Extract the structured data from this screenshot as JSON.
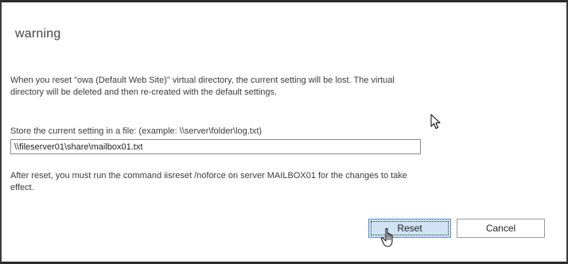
{
  "dialog": {
    "title": "warning",
    "warning_message": "When you reset \"owa (Default Web Site)\" virtual directory, the current setting will be lost. The virtual directory will be deleted and then re-created with the default settings.",
    "store_label": "Store the current setting in a file: (example: \\\\server\\folder\\log.txt)",
    "file_path_value": "\\\\fileserver01\\share\\mailbox01.txt",
    "after_message": "After reset, you must run the command iisreset /noforce on server MAILBOX01 for the changes to take effect.",
    "reset_label": "Reset",
    "cancel_label": "Cancel"
  },
  "icons": {
    "pointer": "arrow-cursor-icon",
    "hand": "hand-cursor-icon"
  },
  "colors": {
    "primary_button_bg": "#cfe3f5",
    "primary_button_border": "#5a8fc7"
  }
}
